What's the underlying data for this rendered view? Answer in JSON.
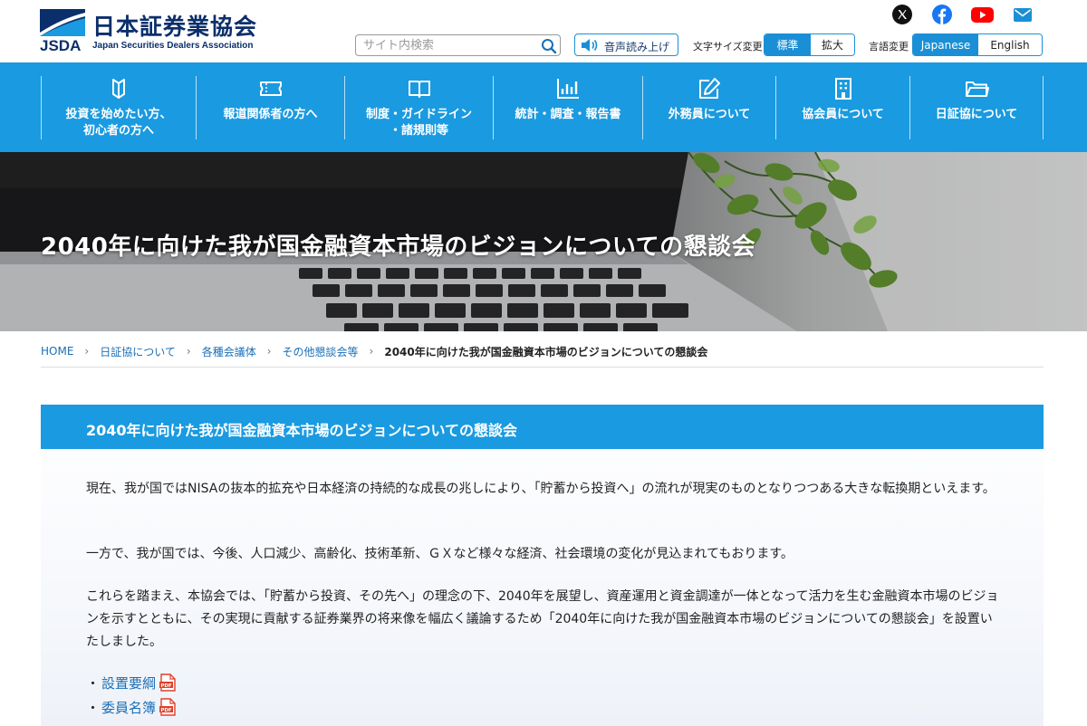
{
  "header": {
    "logo_jp": "日本証券業協会",
    "logo_abbr": "JSDA",
    "logo_en": "Japan Securities Dealers Association",
    "search_placeholder": "サイト内検索",
    "tts_label": "音声読み上げ",
    "font_size_label": "文字サイズ変更",
    "font_size_options": [
      "標準",
      "拡大"
    ],
    "font_size_selected": "標準",
    "language_label": "言語変更",
    "language_options": [
      "Japanese",
      "English"
    ],
    "language_selected": "Japanese",
    "social_icons": [
      "x-icon",
      "facebook-icon",
      "youtube-icon",
      "mail-icon"
    ]
  },
  "nav": {
    "items": [
      {
        "label": "投資を始めたい方、\n初心者の方へ",
        "icon": "book-icon"
      },
      {
        "label": "報道関係者の方へ",
        "icon": "ticket-icon"
      },
      {
        "label": "制度・ガイドライン\n・諸規則等",
        "icon": "open-book-icon"
      },
      {
        "label": "統計・調査・報告書",
        "icon": "bar-chart-icon"
      },
      {
        "label": "外務員について",
        "icon": "pencil-square-icon"
      },
      {
        "label": "協会員について",
        "icon": "building-icon"
      },
      {
        "label": "日証協について",
        "icon": "folder-icon"
      }
    ]
  },
  "hero": {
    "title": "2040年に向けた我が国金融資本市場のビジョンについての懇談会"
  },
  "breadcrumb": {
    "items": [
      "HOME",
      "日証協について",
      "各種会議体",
      "その他懇談会等"
    ],
    "current": "2040年に向けた我が国金融資本市場のビジョンについての懇談会"
  },
  "main": {
    "section_title": "2040年に向けた我が国金融資本市場のビジョンについての懇談会",
    "paragraphs": [
      "現在、我が国ではNISAの抜本的拡充や日本経済の持続的な成長の兆しにより、「貯蓄から投資へ」の流れが現実のものとなりつつある大きな転換期といえます。",
      "一方で、我が国では、今後、人口減少、高齢化、技術革新、ＧＸなど様々な経済、社会環境の変化が見込まれてもおります。",
      "これらを踏まえ、本協会では、「貯蓄から投資、その先へ」の理念の下、2040年を展望し、資産運用と資金調達が一体となって活力を生む金融資本市場のビジョンを示すとともに、その実現に貢献する証券業界の将来像を幅広く議論するため「2040年に向けた我が国金融資本市場のビジョンについての懇談会」を設置いたしました。"
    ],
    "bullet": "・",
    "links": [
      {
        "label": "設置要綱",
        "icon": "pdf-icon"
      },
      {
        "label": "委員名簿",
        "icon": "pdf-icon"
      }
    ],
    "colors": {
      "accent": "#1a9ae0",
      "link": "#1a6fb6",
      "brand_navy": "#0b2f6b",
      "pdf_red": "#e0402a"
    }
  }
}
